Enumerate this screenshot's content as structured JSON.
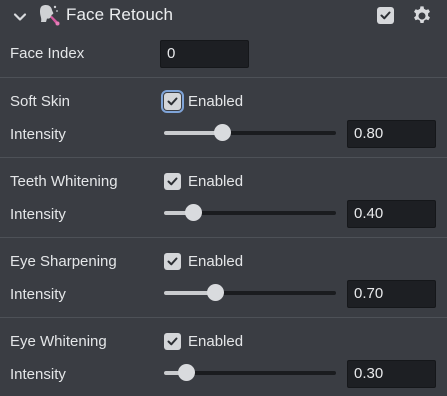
{
  "header": {
    "title": "Face Retouch",
    "enabled": true,
    "icons": {
      "collapse": "chevron-down-icon",
      "face": "face-retouch-icon",
      "settings": "gear-icon"
    }
  },
  "face_index": {
    "label": "Face Index",
    "value": "0"
  },
  "sections": [
    {
      "name": "Soft Skin",
      "checkbox_label": "Enabled",
      "checked": true,
      "focused": true,
      "slider_label": "Intensity",
      "value": "0.80",
      "level": 0.8
    },
    {
      "name": "Teeth Whitening",
      "checkbox_label": "Enabled",
      "checked": true,
      "focused": false,
      "slider_label": "Intensity",
      "value": "0.40",
      "level": 0.4
    },
    {
      "name": "Eye Sharpening",
      "checkbox_label": "Enabled",
      "checked": true,
      "focused": false,
      "slider_label": "Intensity",
      "value": "0.70",
      "level": 0.7
    },
    {
      "name": "Eye Whitening",
      "checkbox_label": "Enabled",
      "checked": true,
      "focused": false,
      "slider_label": "Intensity",
      "value": "0.30",
      "level": 0.3
    }
  ],
  "colors": {
    "background": "#3a3d43",
    "field": "#1d1f23",
    "accent": "#d4d6d9"
  }
}
